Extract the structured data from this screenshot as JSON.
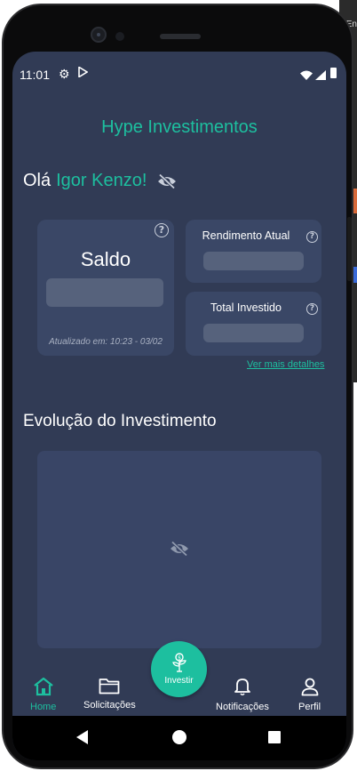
{
  "desktop": {
    "edge_text": "En"
  },
  "status_bar": {
    "time": "11:01",
    "icons": [
      "gear-icon",
      "play-store-icon",
      "wifi-icon",
      "signal-icon",
      "battery-icon"
    ]
  },
  "app": {
    "title": "Hype Investimentos",
    "greeting": "Olá",
    "user_name": "Igor Kenzo!",
    "visibility_icon": "eye-off-icon"
  },
  "cards": {
    "saldo": {
      "label": "Saldo",
      "updated": "Atualizado em: 10:23 - 03/02",
      "help_icon": "?"
    },
    "rendimento": {
      "label": "Rendimento Atual",
      "help_icon": "?"
    },
    "total": {
      "label": "Total Investido",
      "help_icon": "?"
    }
  },
  "more_details": "Ver mais detalhes",
  "evolution": {
    "title": "Evolução do Investimento"
  },
  "bottom_nav": {
    "items": [
      {
        "label": "Home",
        "icon": "home-icon",
        "active": true
      },
      {
        "label": "Solicitações",
        "icon": "folder-icon"
      },
      {
        "label": "Notificações",
        "icon": "bell-icon"
      },
      {
        "label": "Perfil",
        "icon": "user-icon"
      }
    ],
    "fab": {
      "label": "Investir",
      "icon": "plant-money-icon"
    }
  },
  "colors": {
    "accent": "#1dbf9f",
    "background": "#313b55",
    "card": "#3a4766",
    "skeleton": "#56627c"
  }
}
